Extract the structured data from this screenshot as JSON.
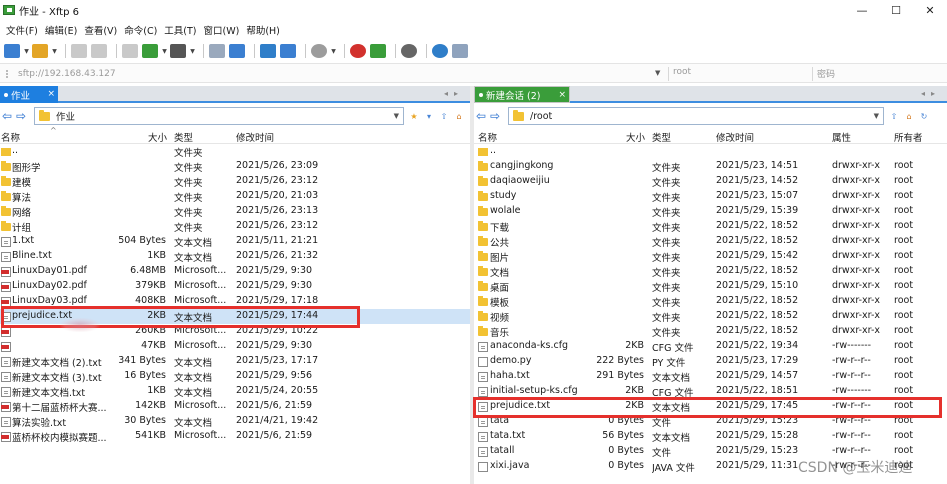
{
  "window": {
    "title": "作业 - Xftp 6",
    "min_glyph": "—",
    "max_glyph": "☐",
    "close_glyph": "✕"
  },
  "menu": [
    "文件(F)",
    "编辑(E)",
    "查看(V)",
    "命令(C)",
    "工具(T)",
    "窗口(W)",
    "帮助(H)"
  ],
  "address": {
    "host_placeholder": "sftp://192.168.43.127",
    "user_placeholder": "root",
    "password_placeholder": "密码"
  },
  "left": {
    "tab": "作业",
    "path": "作业",
    "headers": {
      "name": "名称",
      "size": "大小",
      "type": "类型",
      "modified": "修改时间"
    },
    "rows": [
      {
        "icon": "up",
        "name": "..",
        "size": "",
        "type": "文件夹",
        "modified": ""
      },
      {
        "icon": "folder",
        "name": "图形学",
        "size": "",
        "type": "文件夹",
        "modified": "2021/5/26, 23:09"
      },
      {
        "icon": "folder",
        "name": "建模",
        "size": "",
        "type": "文件夹",
        "modified": "2021/5/26, 23:12"
      },
      {
        "icon": "folder",
        "name": "算法",
        "size": "",
        "type": "文件夹",
        "modified": "2021/5/20, 21:03"
      },
      {
        "icon": "folder",
        "name": "网络",
        "size": "",
        "type": "文件夹",
        "modified": "2021/5/26, 23:13"
      },
      {
        "icon": "folder",
        "name": "计组",
        "size": "",
        "type": "文件夹",
        "modified": "2021/5/26, 23:12"
      },
      {
        "icon": "txt",
        "name": "1.txt",
        "size": "504 Bytes",
        "type": "文本文档",
        "modified": "2021/5/11, 21:21"
      },
      {
        "icon": "txt",
        "name": "Bline.txt",
        "size": "1KB",
        "type": "文本文档",
        "modified": "2021/5/26, 21:32"
      },
      {
        "icon": "pdf",
        "name": "LinuxDay01.pdf",
        "size": "6.48MB",
        "type": "Microsoft...",
        "modified": "2021/5/29, 9:30"
      },
      {
        "icon": "pdf",
        "name": "LinuxDay02.pdf",
        "size": "379KB",
        "type": "Microsoft...",
        "modified": "2021/5/29, 9:30"
      },
      {
        "icon": "pdf",
        "name": "LinuxDay03.pdf",
        "size": "408KB",
        "type": "Microsoft...",
        "modified": "2021/5/29, 17:18"
      },
      {
        "icon": "txt",
        "name": "prejudice.txt",
        "size": "2KB",
        "type": "文本文档",
        "modified": "2021/5/29, 17:44"
      },
      {
        "icon": "pdf",
        "name": "",
        "size": "260KB",
        "type": "Microsoft...",
        "modified": "2021/5/29, 10:22"
      },
      {
        "icon": "pdf",
        "name": "",
        "size": "47KB",
        "type": "Microsoft...",
        "modified": "2021/5/29, 9:30"
      },
      {
        "icon": "txt",
        "name": "新建文本文档 (2).txt",
        "size": "341 Bytes",
        "type": "文本文档",
        "modified": "2021/5/23, 17:17"
      },
      {
        "icon": "txt",
        "name": "新建文本文档 (3).txt",
        "size": "16 Bytes",
        "type": "文本文档",
        "modified": "2021/5/29, 9:56"
      },
      {
        "icon": "txt",
        "name": "新建文本文档.txt",
        "size": "1KB",
        "type": "文本文档",
        "modified": "2021/5/24, 20:55"
      },
      {
        "icon": "pdf",
        "name": "第十二届蓝桥杯大赛...",
        "size": "142KB",
        "type": "Microsoft...",
        "modified": "2021/5/6, 21:59"
      },
      {
        "icon": "txt",
        "name": "算法实验.txt",
        "size": "30 Bytes",
        "type": "文本文档",
        "modified": "2021/4/21, 19:42"
      },
      {
        "icon": "pdf",
        "name": "蓝桥杯校内模拟赛题...",
        "size": "541KB",
        "type": "Microsoft...",
        "modified": "2021/5/6, 21:59"
      }
    ]
  },
  "right": {
    "tab": "新建会话 (2)",
    "path": "/root",
    "headers": {
      "name": "名称",
      "size": "大小",
      "type": "类型",
      "modified": "修改时间",
      "attrs": "属性",
      "owner": "所有者"
    },
    "rows": [
      {
        "icon": "up",
        "name": "..",
        "size": "",
        "type": "",
        "modified": "",
        "attrs": "",
        "owner": ""
      },
      {
        "icon": "folder",
        "name": "cangjingkong",
        "size": "",
        "type": "文件夹",
        "modified": "2021/5/23, 14:51",
        "attrs": "drwxr-xr-x",
        "owner": "root"
      },
      {
        "icon": "folder",
        "name": "daqiaoweijiu",
        "size": "",
        "type": "文件夹",
        "modified": "2021/5/23, 14:52",
        "attrs": "drwxr-xr-x",
        "owner": "root"
      },
      {
        "icon": "folder",
        "name": "study",
        "size": "",
        "type": "文件夹",
        "modified": "2021/5/23, 15:07",
        "attrs": "drwxr-xr-x",
        "owner": "root"
      },
      {
        "icon": "folder",
        "name": "wolale",
        "size": "",
        "type": "文件夹",
        "modified": "2021/5/29, 15:39",
        "attrs": "drwxr-xr-x",
        "owner": "root"
      },
      {
        "icon": "folder",
        "name": "下载",
        "size": "",
        "type": "文件夹",
        "modified": "2021/5/22, 18:52",
        "attrs": "drwxr-xr-x",
        "owner": "root"
      },
      {
        "icon": "folder",
        "name": "公共",
        "size": "",
        "type": "文件夹",
        "modified": "2021/5/22, 18:52",
        "attrs": "drwxr-xr-x",
        "owner": "root"
      },
      {
        "icon": "folder",
        "name": "图片",
        "size": "",
        "type": "文件夹",
        "modified": "2021/5/29, 15:42",
        "attrs": "drwxr-xr-x",
        "owner": "root"
      },
      {
        "icon": "folder",
        "name": "文档",
        "size": "",
        "type": "文件夹",
        "modified": "2021/5/22, 18:52",
        "attrs": "drwxr-xr-x",
        "owner": "root"
      },
      {
        "icon": "folder",
        "name": "桌面",
        "size": "",
        "type": "文件夹",
        "modified": "2021/5/29, 15:10",
        "attrs": "drwxr-xr-x",
        "owner": "root"
      },
      {
        "icon": "folder",
        "name": "模板",
        "size": "",
        "type": "文件夹",
        "modified": "2021/5/22, 18:52",
        "attrs": "drwxr-xr-x",
        "owner": "root"
      },
      {
        "icon": "folder",
        "name": "视频",
        "size": "",
        "type": "文件夹",
        "modified": "2021/5/22, 18:52",
        "attrs": "drwxr-xr-x",
        "owner": "root"
      },
      {
        "icon": "folder",
        "name": "音乐",
        "size": "",
        "type": "文件夹",
        "modified": "2021/5/22, 18:52",
        "attrs": "drwxr-xr-x",
        "owner": "root"
      },
      {
        "icon": "txt",
        "name": "anaconda-ks.cfg",
        "size": "2KB",
        "type": "CFG 文件",
        "modified": "2021/5/22, 19:34",
        "attrs": "-rw-------",
        "owner": "root"
      },
      {
        "icon": "code",
        "name": "demo.py",
        "size": "222 Bytes",
        "type": "PY 文件",
        "modified": "2021/5/23, 17:29",
        "attrs": "-rw-r--r--",
        "owner": "root"
      },
      {
        "icon": "txt",
        "name": "haha.txt",
        "size": "291 Bytes",
        "type": "文本文档",
        "modified": "2021/5/29, 14:57",
        "attrs": "-rw-r--r--",
        "owner": "root"
      },
      {
        "icon": "txt",
        "name": "initial-setup-ks.cfg",
        "size": "2KB",
        "type": "CFG 文件",
        "modified": "2021/5/22, 18:51",
        "attrs": "-rw-------",
        "owner": "root"
      },
      {
        "icon": "txt",
        "name": "prejudice.txt",
        "size": "2KB",
        "type": "文本文档",
        "modified": "2021/5/29, 17:45",
        "attrs": "-rw-r--r--",
        "owner": "root"
      },
      {
        "icon": "txt",
        "name": "tata",
        "size": "0 Bytes",
        "type": "文件",
        "modified": "2021/5/29, 15:23",
        "attrs": "-rw-r--r--",
        "owner": "root"
      },
      {
        "icon": "txt",
        "name": "tata.txt",
        "size": "56 Bytes",
        "type": "文本文档",
        "modified": "2021/5/29, 15:28",
        "attrs": "-rw-r--r--",
        "owner": "root"
      },
      {
        "icon": "txt",
        "name": "tatall",
        "size": "0 Bytes",
        "type": "文件",
        "modified": "2021/5/29, 15:23",
        "attrs": "-rw-r--r--",
        "owner": "root"
      },
      {
        "icon": "code",
        "name": "xixi.java",
        "size": "0 Bytes",
        "type": "JAVA 文件",
        "modified": "2021/5/29, 11:31",
        "attrs": "-rw-r--r--",
        "owner": "root"
      }
    ]
  },
  "watermark": "CSDN @玉米迪迪",
  "colors": {
    "accent_blue": "#1e7fe0",
    "session_green": "#3a9d3a",
    "highlight_red": "#e5302c",
    "selection": "#cfe3f7"
  }
}
